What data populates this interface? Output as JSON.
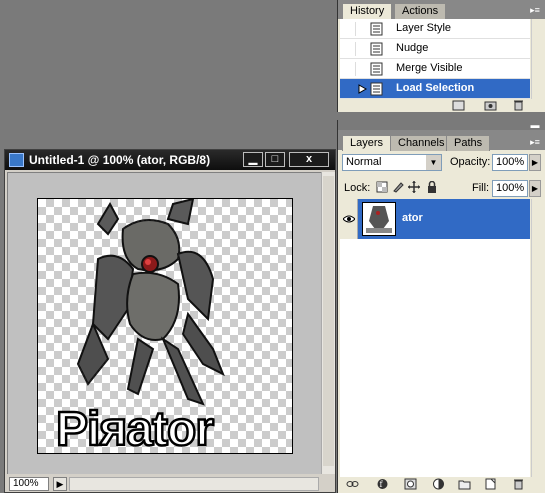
{
  "document": {
    "title": "Untitled-1 @ 100% (ator, RGB/8)",
    "zoom": "100%",
    "buttons": {
      "minimize": "▁",
      "maximize": "□",
      "close": "x"
    },
    "artwork_text": "Piяator"
  },
  "history": {
    "tabs": [
      "History",
      "Actions"
    ],
    "active_tab": "History",
    "items": [
      {
        "label": "Layer Style",
        "selected": false
      },
      {
        "label": "Nudge",
        "selected": false
      },
      {
        "label": "Merge Visible",
        "selected": false
      },
      {
        "label": "Load Selection",
        "selected": true
      }
    ]
  },
  "layers": {
    "tabs": [
      "Layers",
      "Channels",
      "Paths"
    ],
    "active_tab": "Layers",
    "blend_mode": "Normal",
    "opacity_label": "Opacity:",
    "opacity": "100%",
    "lock_label": "Lock:",
    "fill_label": "Fill:",
    "fill": "100%",
    "items": [
      {
        "name": "ator",
        "visible": true,
        "selected": true
      }
    ]
  },
  "colors": {
    "selection": "#316ac5",
    "panel_bg": "#ece9d8",
    "title_bar": "#111111",
    "workspace": "#7a7a7a"
  }
}
